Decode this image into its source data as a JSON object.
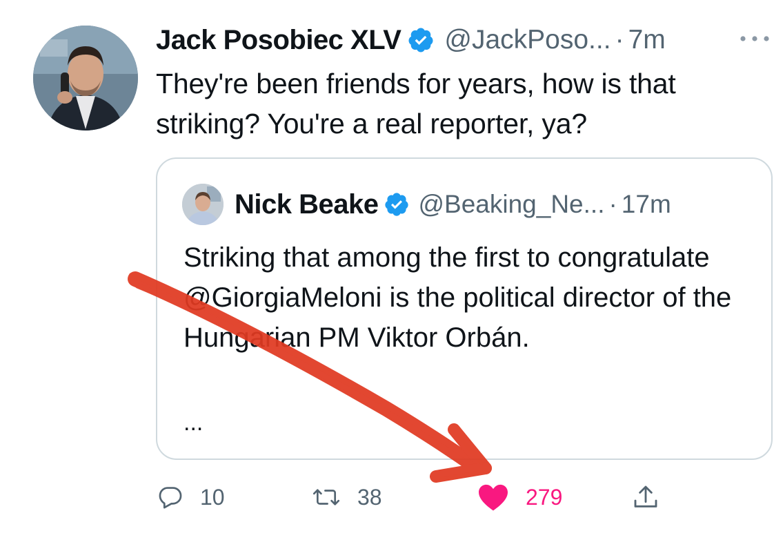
{
  "colors": {
    "text": "#0f1419",
    "muted": "#536471",
    "verified": "#1d9bf0",
    "like": "#f91880",
    "annotation_arrow": "#e03a22",
    "border": "#cfd9de"
  },
  "tweet": {
    "author_name": "Jack Posobiec XLV",
    "handle": "@JackPoso...",
    "separator": "·",
    "time": "7m",
    "text": "They're been friends for years, how is that striking? You're a real reporter, ya?",
    "more_icon": "more-horizontal-icon"
  },
  "quoted_tweet": {
    "author_name": "Nick Beake",
    "handle": "@Beaking_Ne...",
    "separator": "·",
    "time": "17m",
    "text": "Striking that among the first to congratulate @GiorgiaMeloni is the political director of the Hungarian PM Viktor Orbán.",
    "ellipsis": "..."
  },
  "actions": {
    "reply_count": "10",
    "retweet_count": "38",
    "like_count": "279",
    "reply_icon": "reply-icon",
    "retweet_icon": "retweet-icon",
    "like_icon": "heart-icon",
    "share_icon": "share-icon",
    "liked": true
  }
}
